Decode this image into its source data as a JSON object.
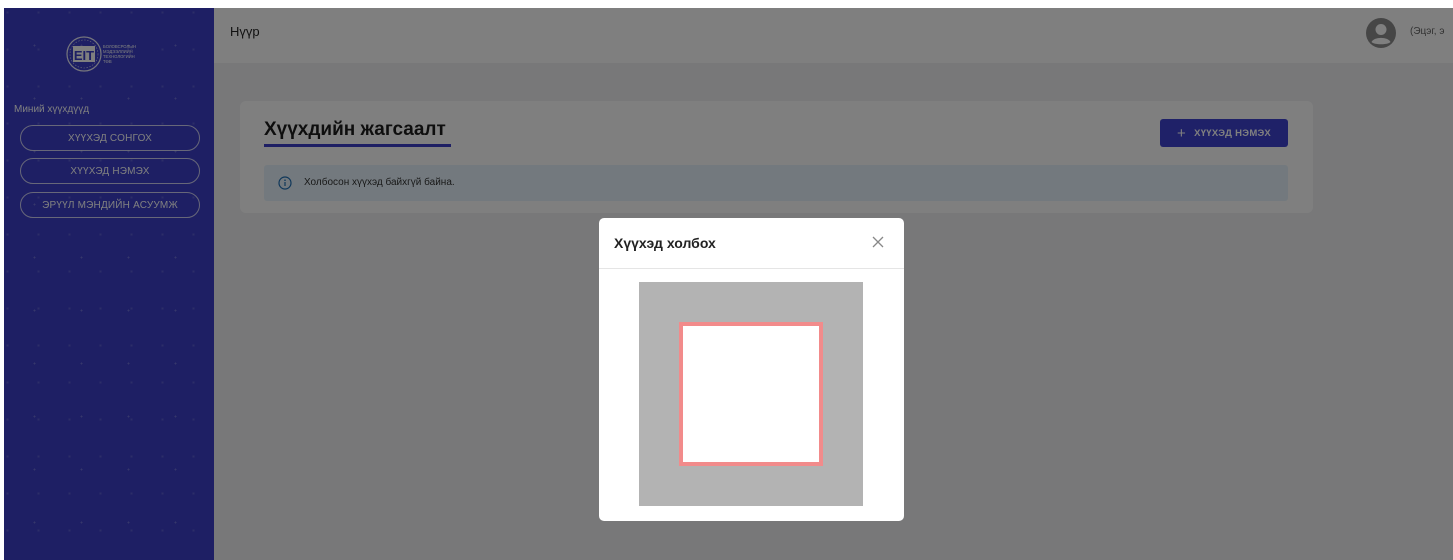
{
  "sidebar": {
    "logo_letters": "EIT",
    "logo_subtext": [
      "БОЛОВСРОЛЫН",
      "МЭДЭЭЛЛИЙН",
      "ТЕХНОЛОГИЙН",
      "ТӨВ"
    ],
    "heading": "Миний хүүхдүүд",
    "items": [
      {
        "label": "ХҮҮХЭД СОНГОХ"
      },
      {
        "label": "ХҮҮХЭД НЭМЭХ"
      },
      {
        "label": "ЭРҮҮЛ МЭНДИЙН АСУУМЖ"
      }
    ],
    "color": "#3c3fc9"
  },
  "topbar": {
    "title": "Нүүр",
    "user_name": "(Эцэг, э",
    "avatar_icon": "user-circle-icon"
  },
  "card": {
    "title": "Хүүхдийн жагсаалт",
    "add_button_label": "ХҮҮХЭД НЭМЭХ",
    "add_button_icon": "plus-icon",
    "alert_text": "Холбосон хүүхэд байхгүй байна.",
    "alert_icon": "info-icon",
    "accent": "#3f43d0",
    "alert_bg": "#e6f3fc"
  },
  "modal": {
    "title": "Хүүхэд холбох",
    "close_icon": "close-icon",
    "scan_frame_color": "#f28b8b"
  }
}
